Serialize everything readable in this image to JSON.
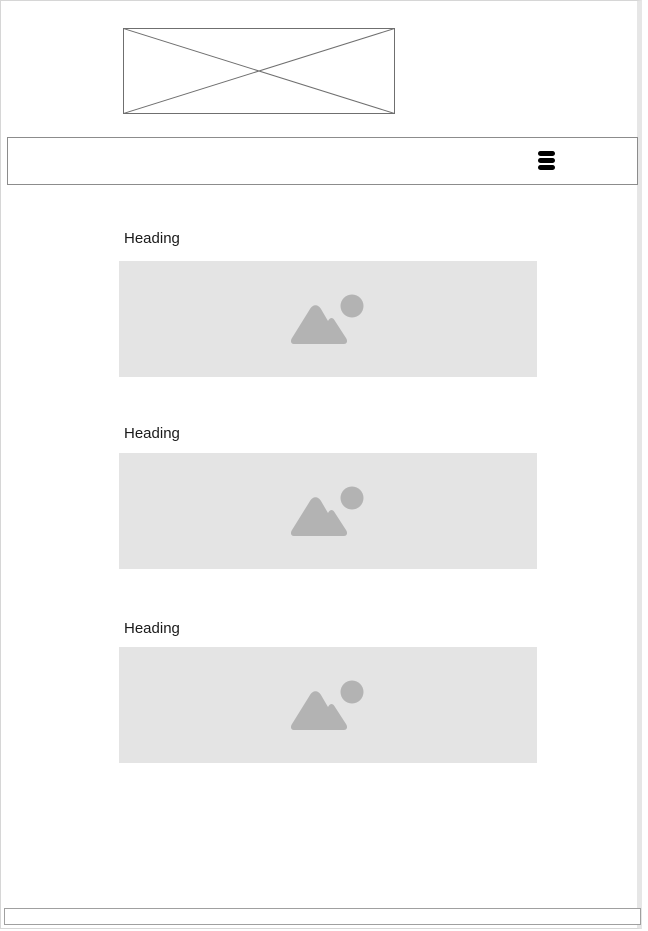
{
  "header": {
    "logo_icon": "image-placeholder-x-icon",
    "menu_icon": "hamburger-menu-icon"
  },
  "sections": [
    {
      "heading": "Heading",
      "image_icon": "mountain-sun-image-icon"
    },
    {
      "heading": "Heading",
      "image_icon": "mountain-sun-image-icon"
    },
    {
      "heading": "Heading",
      "image_icon": "mountain-sun-image-icon"
    }
  ],
  "colors": {
    "placeholder_fill": "#e4e4e4",
    "placeholder_icon": "#b3b3b3",
    "border": "#8c8c8c",
    "text": "#1a1a1a"
  }
}
